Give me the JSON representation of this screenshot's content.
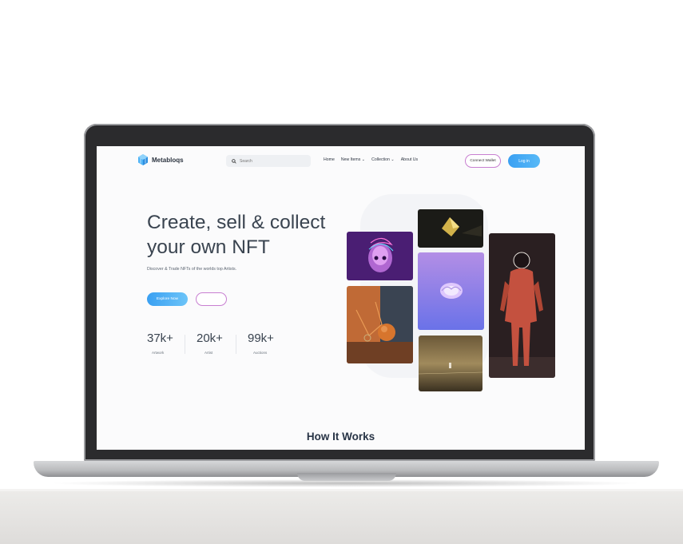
{
  "navbar": {
    "brand": "Metabloqs",
    "search_placeholder": "Search",
    "links": [
      "Home",
      "New Items ⌄",
      "Collection ⌄",
      "About Us"
    ],
    "connect_wallet": "Connect Wallet",
    "login": "Log in"
  },
  "hero": {
    "title_line1": "Create, sell & collect",
    "title_line2": "your own NFT",
    "subtitle": "Discover & Trade NFTs of the worlds top Artists.",
    "explore_button": "Explore Now",
    "secondary_button": ""
  },
  "stats": [
    {
      "value": "37k+",
      "label": "Artwork"
    },
    {
      "value": "20k+",
      "label": "Artist"
    },
    {
      "value": "99k+",
      "label": "Auctions"
    }
  ],
  "gallery": {
    "items": [
      {
        "name": "neon-skull",
        "icon": "neon-skull-art"
      },
      {
        "name": "golden-pyramid",
        "icon": "golden-shape-art"
      },
      {
        "name": "glowing-brain",
        "icon": "brain-art"
      },
      {
        "name": "red-suit-figure",
        "icon": "figure-art"
      },
      {
        "name": "still-life-sphere",
        "icon": "sphere-art"
      },
      {
        "name": "desert-figure",
        "icon": "landscape-art"
      }
    ]
  },
  "section": {
    "how_it_works": "How It Works"
  },
  "colors": {
    "accent_blue": "#3aa0f2",
    "accent_pink": "#c87fd1",
    "text_dark": "#3a4450"
  }
}
